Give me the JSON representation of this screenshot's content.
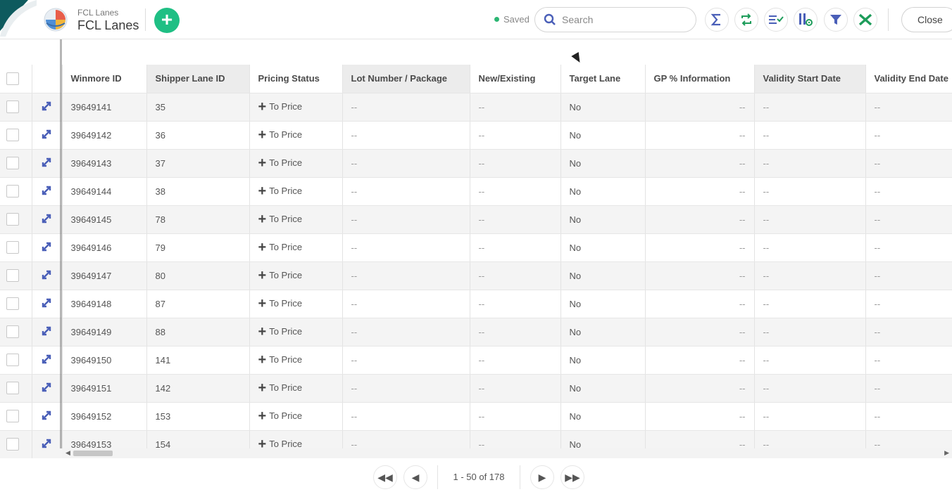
{
  "header": {
    "breadcrumb": "FCL Lanes",
    "title": "FCL Lanes",
    "add_icon": "plus",
    "saved_label": "Saved",
    "search_placeholder": "Search",
    "close_label": "Close",
    "tools": [
      "sum-icon",
      "sync-icon",
      "sort-check-icon",
      "column-settings-icon",
      "filter-icon",
      "excel-icon"
    ]
  },
  "colors": {
    "accent_green": "#1fbf84",
    "icon_blue": "#4a5fb8",
    "excel_green": "#1d9c5a"
  },
  "grid": {
    "columns": [
      "Winmore ID",
      "Shipper Lane ID",
      "Pricing Status",
      "Lot Number / Package",
      "New/Existing",
      "Target Lane",
      "GP % Information",
      "Validity Start Date",
      "Validity End Date"
    ],
    "rows": [
      {
        "id": "39649141",
        "lane": "35",
        "status": "To Price",
        "lot": "--",
        "newex": "--",
        "target": "No",
        "gp": "--",
        "start": "--",
        "end": "--"
      },
      {
        "id": "39649142",
        "lane": "36",
        "status": "To Price",
        "lot": "--",
        "newex": "--",
        "target": "No",
        "gp": "--",
        "start": "--",
        "end": "--"
      },
      {
        "id": "39649143",
        "lane": "37",
        "status": "To Price",
        "lot": "--",
        "newex": "--",
        "target": "No",
        "gp": "--",
        "start": "--",
        "end": "--"
      },
      {
        "id": "39649144",
        "lane": "38",
        "status": "To Price",
        "lot": "--",
        "newex": "--",
        "target": "No",
        "gp": "--",
        "start": "--",
        "end": "--"
      },
      {
        "id": "39649145",
        "lane": "78",
        "status": "To Price",
        "lot": "--",
        "newex": "--",
        "target": "No",
        "gp": "--",
        "start": "--",
        "end": "--"
      },
      {
        "id": "39649146",
        "lane": "79",
        "status": "To Price",
        "lot": "--",
        "newex": "--",
        "target": "No",
        "gp": "--",
        "start": "--",
        "end": "--"
      },
      {
        "id": "39649147",
        "lane": "80",
        "status": "To Price",
        "lot": "--",
        "newex": "--",
        "target": "No",
        "gp": "--",
        "start": "--",
        "end": "--"
      },
      {
        "id": "39649148",
        "lane": "87",
        "status": "To Price",
        "lot": "--",
        "newex": "--",
        "target": "No",
        "gp": "--",
        "start": "--",
        "end": "--"
      },
      {
        "id": "39649149",
        "lane": "88",
        "status": "To Price",
        "lot": "--",
        "newex": "--",
        "target": "No",
        "gp": "--",
        "start": "--",
        "end": "--"
      },
      {
        "id": "39649150",
        "lane": "141",
        "status": "To Price",
        "lot": "--",
        "newex": "--",
        "target": "No",
        "gp": "--",
        "start": "--",
        "end": "--"
      },
      {
        "id": "39649151",
        "lane": "142",
        "status": "To Price",
        "lot": "--",
        "newex": "--",
        "target": "No",
        "gp": "--",
        "start": "--",
        "end": "--"
      },
      {
        "id": "39649152",
        "lane": "153",
        "status": "To Price",
        "lot": "--",
        "newex": "--",
        "target": "No",
        "gp": "--",
        "start": "--",
        "end": "--"
      },
      {
        "id": "39649153",
        "lane": "154",
        "status": "To Price",
        "lot": "--",
        "newex": "--",
        "target": "No",
        "gp": "--",
        "start": "--",
        "end": "--"
      }
    ]
  },
  "pager": {
    "range_label": "1 - 50 of 178"
  }
}
